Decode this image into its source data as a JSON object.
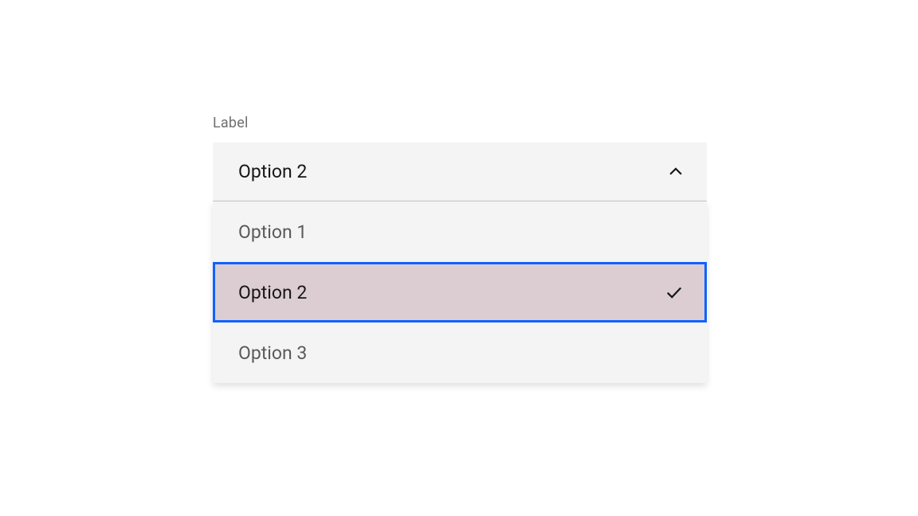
{
  "dropdown": {
    "label": "Label",
    "selected_value": "Option 2",
    "expanded": true,
    "options": [
      {
        "label": "Option 1",
        "selected": false
      },
      {
        "label": "Option 2",
        "selected": true
      },
      {
        "label": "Option 3",
        "selected": false
      }
    ]
  },
  "colors": {
    "focus_outline": "#0f62fe",
    "selected_bg": "#dbcdd2",
    "menu_bg": "#f4f4f4",
    "text_primary": "#161616",
    "text_secondary": "#5a5a5a",
    "label_text": "#6f6f6f"
  }
}
